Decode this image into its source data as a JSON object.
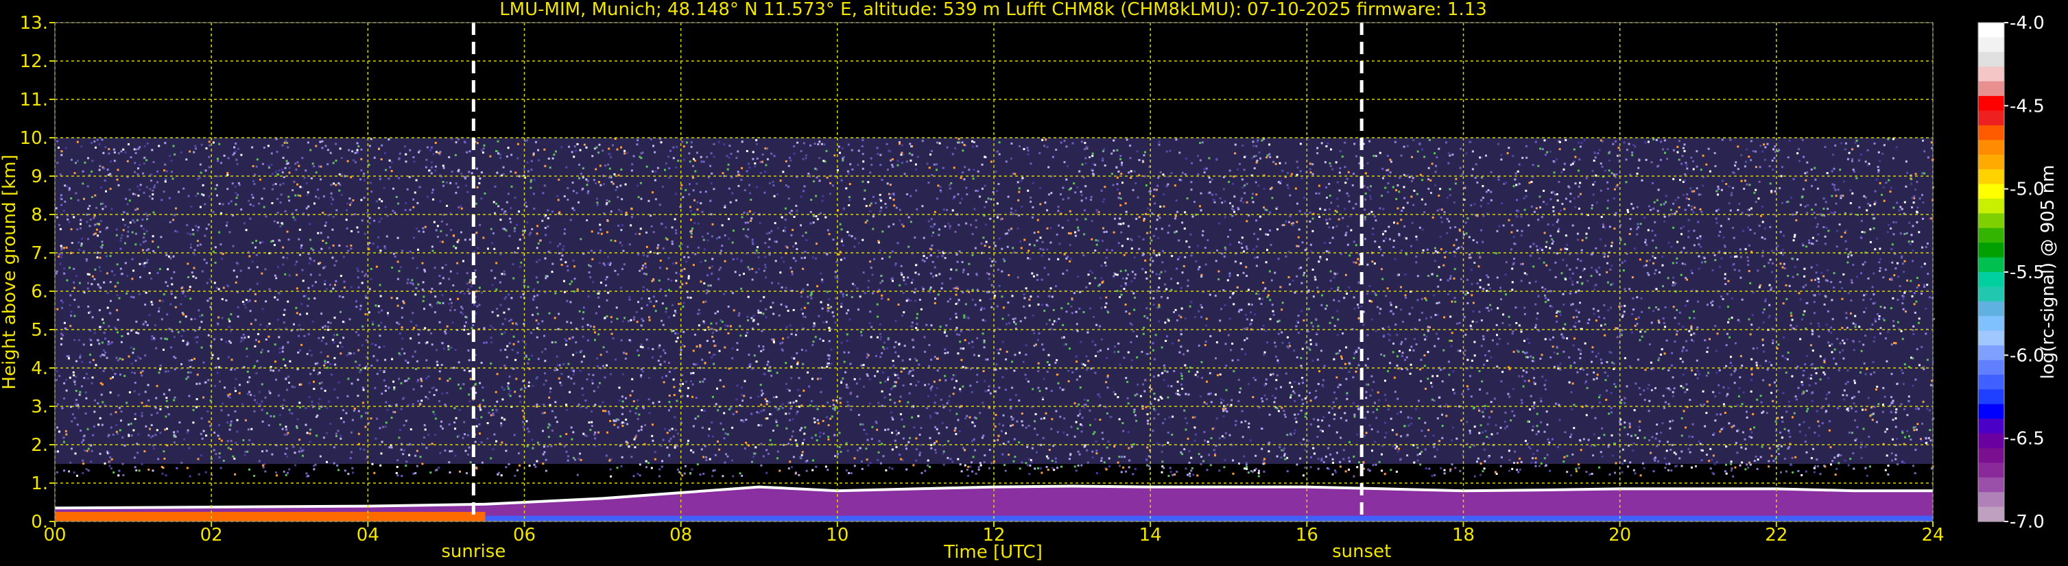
{
  "chart_data": {
    "type": "heatmap",
    "title": "LMU-MIM, Munich; 48.148° N 11.573° E, altitude: 539 m    Lufft CHM8k (CHM8kLMU): 07-10-2025    firmware: 1.13",
    "xlabel": "Time [UTC]",
    "ylabel": "Height above ground [km]",
    "xlim": [
      0,
      24
    ],
    "ylim": [
      0,
      13
    ],
    "x_ticks": [
      "00",
      "02",
      "04",
      "06",
      "08",
      "10",
      "12",
      "14",
      "16",
      "18",
      "20",
      "22",
      "24"
    ],
    "y_ticks": [
      "0.",
      "1.",
      "2.",
      "3.",
      "4.",
      "5.",
      "6.",
      "7.",
      "8.",
      "9.",
      "10.",
      "11.",
      "12.",
      "13."
    ],
    "grid": true,
    "markers": [
      {
        "label": "sunrise",
        "time": 5.35
      },
      {
        "label": "sunset",
        "time": 16.7
      }
    ],
    "colorbar": {
      "label": "log(rc-signal) @ 905 nm",
      "range": [
        -7.0,
        -4.0
      ],
      "ticks": [
        "-4.0",
        "-4.5",
        "-5.0",
        "-5.5",
        "-6.0",
        "-6.5",
        "-7.0"
      ],
      "colors": [
        "#ffffff",
        "#f2f2f2",
        "#e0e0e0",
        "#f4c6c6",
        "#e88f8f",
        "#ff0000",
        "#ee2020",
        "#ff5a00",
        "#ff8c00",
        "#ffaa00",
        "#ffd200",
        "#ffff00",
        "#c8f000",
        "#7fd000",
        "#32b400",
        "#00a000",
        "#00c050",
        "#00d0a0",
        "#20c8b0",
        "#60b0e0",
        "#80c0ff",
        "#a0c8ff",
        "#7fa0ff",
        "#6080ff",
        "#4060ff",
        "#2040ff",
        "#0000ff",
        "#4b00c8",
        "#6a00a0",
        "#7a1090",
        "#8a2a9a",
        "#9a50a8",
        "#b080b8",
        "#c0a0c0"
      ]
    },
    "signal_bands": [
      {
        "name": "noise",
        "top_km": 10.0
      },
      {
        "name": "boundary-layer-top",
        "points": [
          [
            0,
            0.35
          ],
          [
            4,
            0.4
          ],
          [
            5.5,
            0.45
          ],
          [
            6,
            0.5
          ],
          [
            7,
            0.6
          ],
          [
            8,
            0.75
          ],
          [
            9,
            0.9
          ],
          [
            10,
            0.8
          ],
          [
            11,
            0.85
          ],
          [
            12,
            0.9
          ],
          [
            13,
            0.92
          ],
          [
            14,
            0.9
          ],
          [
            15,
            0.9
          ],
          [
            16,
            0.9
          ],
          [
            17,
            0.85
          ],
          [
            18,
            0.8
          ],
          [
            19,
            0.82
          ],
          [
            20,
            0.85
          ],
          [
            21,
            0.85
          ],
          [
            22,
            0.85
          ],
          [
            23,
            0.8
          ],
          [
            24,
            0.8
          ]
        ]
      }
    ]
  }
}
